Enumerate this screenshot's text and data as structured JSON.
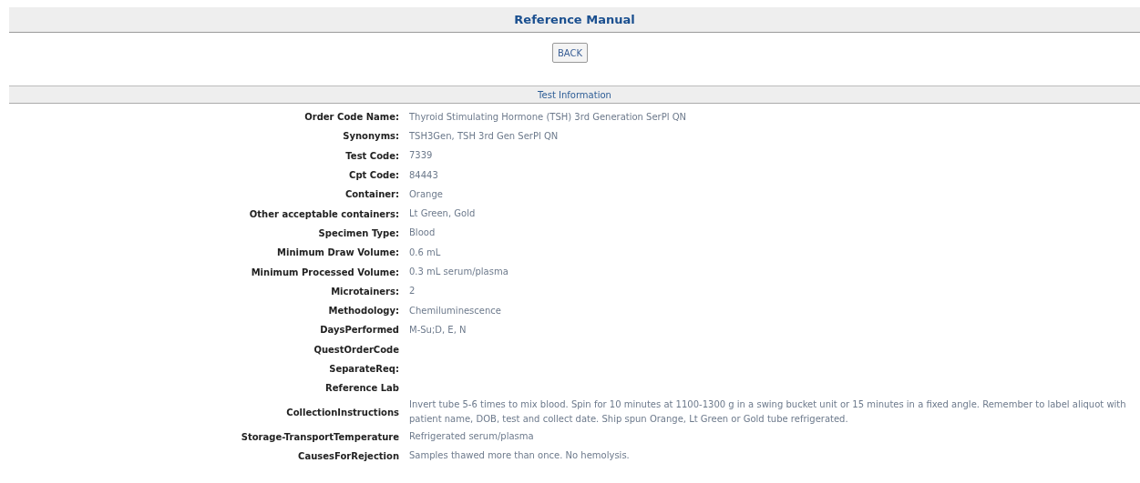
{
  "title": "Reference Manual",
  "back_button": "BACK",
  "section_title": "Test Information",
  "fields": [
    {
      "label": "Order Code Name:",
      "value": "Thyroid Stimulating Hormone (TSH) 3rd Generation SerPl QN"
    },
    {
      "label": "Synonyms:",
      "value": "TSH3Gen, TSH 3rd Gen SerPl QN"
    },
    {
      "label": "Test Code:",
      "value": "7339"
    },
    {
      "label": "Cpt Code:",
      "value": "84443"
    },
    {
      "label": "Container:",
      "value": "Orange"
    },
    {
      "label": "Other acceptable containers:",
      "value": "Lt Green, Gold"
    },
    {
      "label": "Specimen Type:",
      "value": "Blood"
    },
    {
      "label": "Minimum Draw Volume:",
      "value": "0.6 mL"
    },
    {
      "label": "Minimum Processed Volume:",
      "value": "0.3 mL serum/plasma"
    },
    {
      "label": "Microtainers:",
      "value": "2"
    },
    {
      "label": "Methodology:",
      "value": "Chemiluminescence"
    },
    {
      "label": "DaysPerformed",
      "value": "M-Su;D, E, N"
    },
    {
      "label": "QuestOrderCode"
    },
    {
      "label": "SeparateReq:"
    },
    {
      "label": "Reference Lab"
    },
    {
      "label": "CollectionInstructions",
      "value": "Invert tube 5-6 times to mix blood. Spin for 10 minutes at 1100-1300 g in a swing bucket unit or 15 minutes in a fixed angle. Remember to label aliquot with patient name, DOB, test and collect date. Ship spun Orange, Lt Green or Gold tube refrigerated."
    },
    {
      "label": "Storage-TransportTemperature",
      "value": "Refrigerated serum/plasma"
    },
    {
      "label": "CausesForRejection",
      "value": "Samples thawed more than once. No hemolysis."
    }
  ]
}
